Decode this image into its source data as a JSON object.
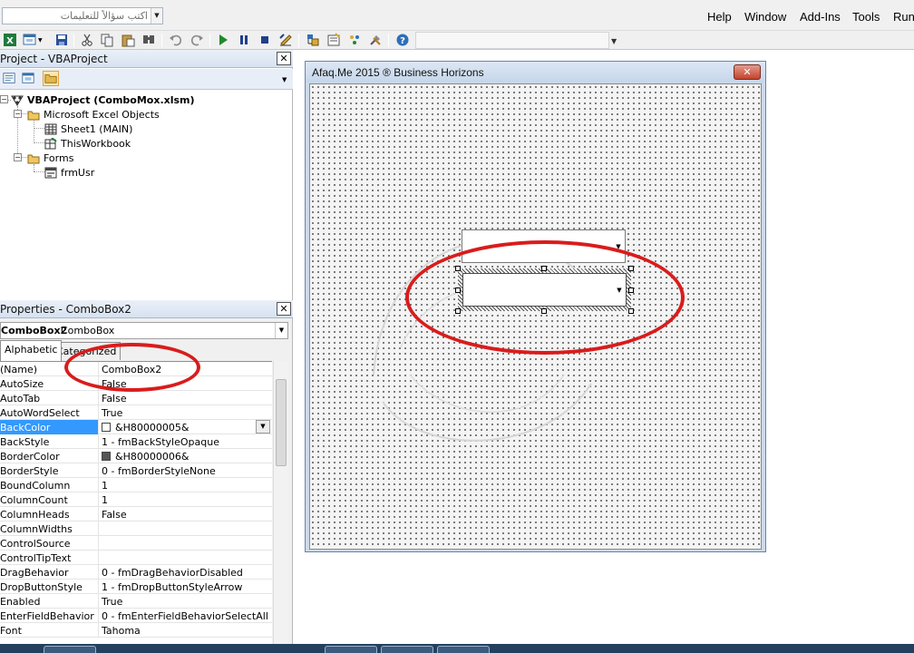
{
  "menubar": {
    "ask_placeholder": "اكتب سؤالاً للتعليمات",
    "items": [
      "Help",
      "Window",
      "Add-Ins",
      "Tools",
      "Run"
    ]
  },
  "project_pane": {
    "title": "Project - VBAProject",
    "tree": [
      {
        "label": "VBAProject (ComboMox.xlsm)",
        "bold": true
      },
      {
        "label": "Microsoft Excel Objects"
      },
      {
        "label": "Sheet1 (MAIN)"
      },
      {
        "label": "ThisWorkbook"
      },
      {
        "label": "Forms"
      },
      {
        "label": "frmUsr"
      }
    ]
  },
  "properties_pane": {
    "title": "Properties - ComboBox2",
    "object_name": "ComboBox2",
    "object_type": "ComboBox",
    "tabs": [
      "Alphabetic",
      "Categorized"
    ],
    "rows": [
      {
        "name": "(Name)",
        "value": "ComboBox2"
      },
      {
        "name": "AutoSize",
        "value": "False"
      },
      {
        "name": "AutoTab",
        "value": "False"
      },
      {
        "name": "AutoWordSelect",
        "value": "True"
      },
      {
        "name": "BackColor",
        "value": "&H80000005&",
        "swatch": "#ffffff",
        "selected": true
      },
      {
        "name": "BackStyle",
        "value": "1 - fmBackStyleOpaque"
      },
      {
        "name": "BorderColor",
        "value": "&H80000006&",
        "swatch": "#555555"
      },
      {
        "name": "BorderStyle",
        "value": "0 - fmBorderStyleNone"
      },
      {
        "name": "BoundColumn",
        "value": "1"
      },
      {
        "name": "ColumnCount",
        "value": "1"
      },
      {
        "name": "ColumnHeads",
        "value": "False"
      },
      {
        "name": "ColumnWidths",
        "value": ""
      },
      {
        "name": "ControlSource",
        "value": ""
      },
      {
        "name": "ControlTipText",
        "value": ""
      },
      {
        "name": "DragBehavior",
        "value": "0 - fmDragBehaviorDisabled"
      },
      {
        "name": "DropButtonStyle",
        "value": "1 - fmDropButtonStyleArrow"
      },
      {
        "name": "Enabled",
        "value": "True"
      },
      {
        "name": "EnterFieldBehavior",
        "value": "0 - fmEnterFieldBehaviorSelectAll"
      },
      {
        "name": "Font",
        "value": "Tahoma"
      }
    ]
  },
  "form": {
    "title": "Afaq.Me 2015 ® Business Horizons",
    "close_label": "✕"
  },
  "colors": {
    "annotation_ring": "#d91c1c",
    "selection": "#3399ff",
    "title_bar": "#d6e2f1"
  }
}
